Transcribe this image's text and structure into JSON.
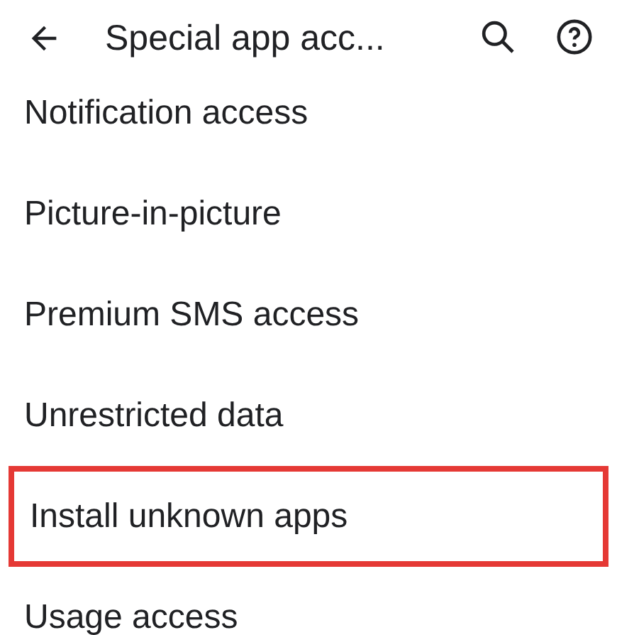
{
  "app_bar": {
    "title": "Special app acc..."
  },
  "items": [
    {
      "label": "Notification access",
      "highlighted": false
    },
    {
      "label": "Picture-in-picture",
      "highlighted": false
    },
    {
      "label": "Premium SMS access",
      "highlighted": false
    },
    {
      "label": "Unrestricted data",
      "highlighted": false
    },
    {
      "label": "Install unknown apps",
      "highlighted": true
    },
    {
      "label": "Usage access",
      "highlighted": false
    }
  ]
}
